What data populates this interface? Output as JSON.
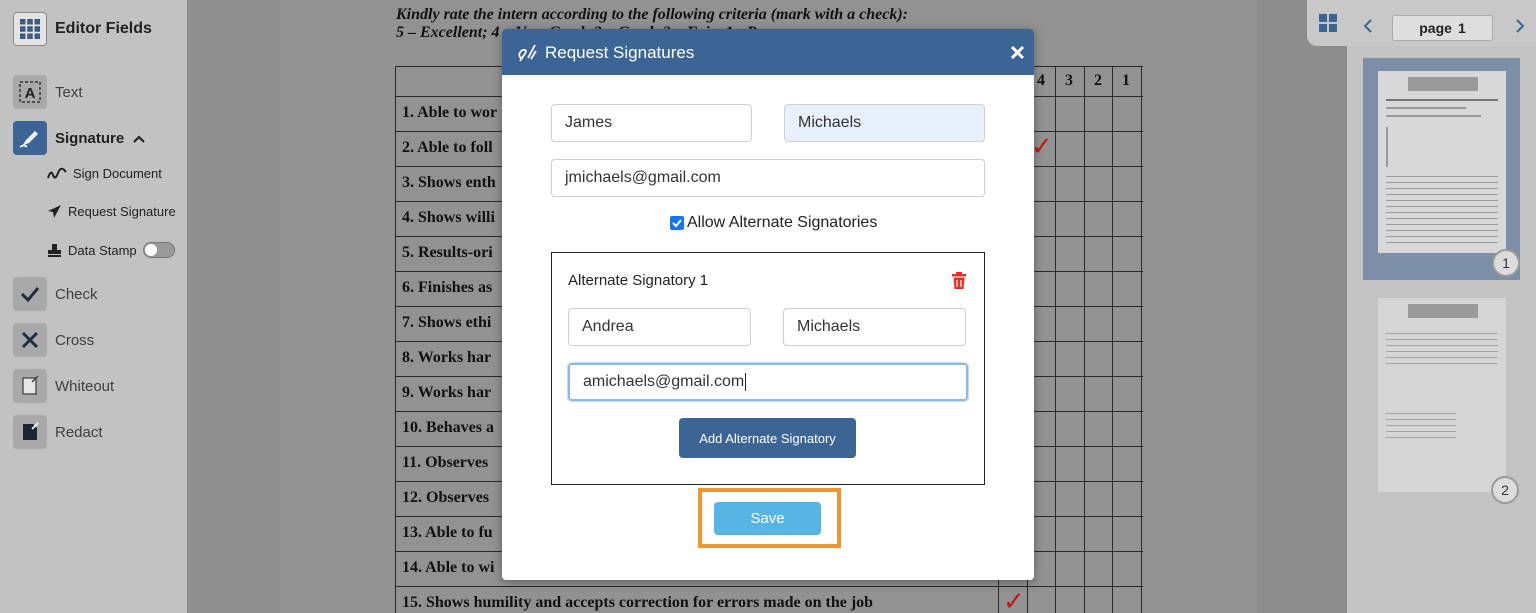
{
  "sidebar": {
    "title": "Editor Fields",
    "items": [
      {
        "label": "Text",
        "icon": "text-box-icon"
      },
      {
        "label": "Signature",
        "icon": "signature-pen-icon"
      },
      {
        "label": "Check",
        "icon": "check-icon"
      },
      {
        "label": "Cross",
        "icon": "cross-icon"
      },
      {
        "label": "Whiteout",
        "icon": "whiteout-icon"
      },
      {
        "label": "Redact",
        "icon": "redact-icon"
      }
    ],
    "signature_sub": [
      {
        "label": "Sign Document",
        "icon": "squiggle-icon"
      },
      {
        "label": "Request Signature",
        "icon": "paper-plane-icon"
      },
      {
        "label": "Data Stamp",
        "icon": "stamp-icon"
      }
    ]
  },
  "document": {
    "intro_line1": "Kindly rate the intern according to the following criteria (mark with a check):",
    "intro_line2": "5 – Excellent;  4 – Very Good;  3 – Good;  2 – Fair;  1 - Poor",
    "rating_headers": [
      "4",
      "3",
      "2",
      "1"
    ],
    "criteria": [
      "1. Able to wor",
      "2. Able to foll",
      "3. Shows enth",
      "4. Shows willi",
      "5. Results-ori",
      "6. Finishes as",
      "7. Shows ethi",
      "8. Works har",
      "9. Works har",
      "10. Behaves a",
      "11. Observes",
      "12. Observes",
      "13. Able to fu",
      "14. Able to wi",
      "15. Shows humility and accepts correction for errors made on the job"
    ]
  },
  "pager": {
    "page_label": "page",
    "page_number": "1",
    "thumbnails": [
      "1",
      "2"
    ]
  },
  "modal": {
    "title": "Request Signatures",
    "first_name": "James",
    "last_name": "Michaels",
    "email": "jmichaels@gmail.com",
    "allow_alternates_label": "Allow Alternate Signatories",
    "allow_alternates_checked": true,
    "alternate": {
      "heading": "Alternate Signatory 1",
      "first_name": "Andrea",
      "last_name": "Michaels",
      "email": "amichaels@gmail.com"
    },
    "add_button": "Add Alternate Signatory",
    "save_button": "Save"
  },
  "colors": {
    "modal_header": "#3c6595",
    "add_button": "#3c6595",
    "save_button": "#58b4e2",
    "highlight_box": "#f0962e",
    "delete_icon": "#e03020",
    "check_mark": "#c41818",
    "focused_border": "#8fb8ea",
    "autofill_bg": "#e8f0fe"
  }
}
